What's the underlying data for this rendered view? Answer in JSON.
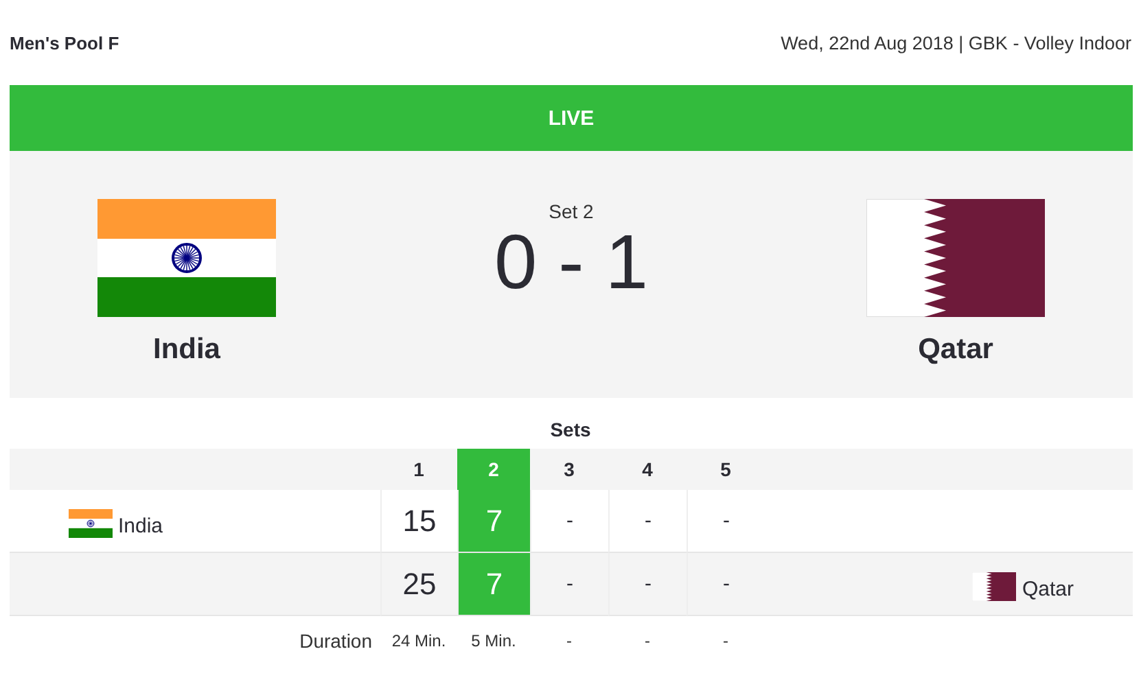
{
  "header": {
    "title": "Men's Pool F",
    "info": "Wed, 22nd Aug 2018 | GBK - Volley Indoor"
  },
  "status": "LIVE",
  "match": {
    "set_label": "Set 2",
    "score": "0 - 1",
    "teams": [
      {
        "name": "India",
        "flag": {
          "kind": "india"
        }
      },
      {
        "name": "Qatar",
        "flag": {
          "kind": "qatar"
        }
      }
    ]
  },
  "sets": {
    "title": "Sets",
    "columns": [
      {
        "label": "1",
        "selected": false
      },
      {
        "label": "2",
        "selected": true
      },
      {
        "label": "3",
        "selected": false
      },
      {
        "label": "4",
        "selected": false
      },
      {
        "label": "5",
        "selected": false
      }
    ],
    "rows": [
      {
        "kind": "home",
        "team": "India",
        "flag": {
          "kind": "india"
        },
        "scores": [
          "15",
          "7",
          "-",
          "-",
          "-"
        ]
      },
      {
        "kind": "away",
        "team": "Qatar",
        "flag": {
          "kind": "qatar"
        },
        "scores": [
          "25",
          "7",
          "-",
          "-",
          "-"
        ]
      }
    ],
    "duration": {
      "label": "Duration",
      "values": [
        "24 Min.",
        "5 Min.",
        "-",
        "-",
        "-"
      ]
    }
  }
}
